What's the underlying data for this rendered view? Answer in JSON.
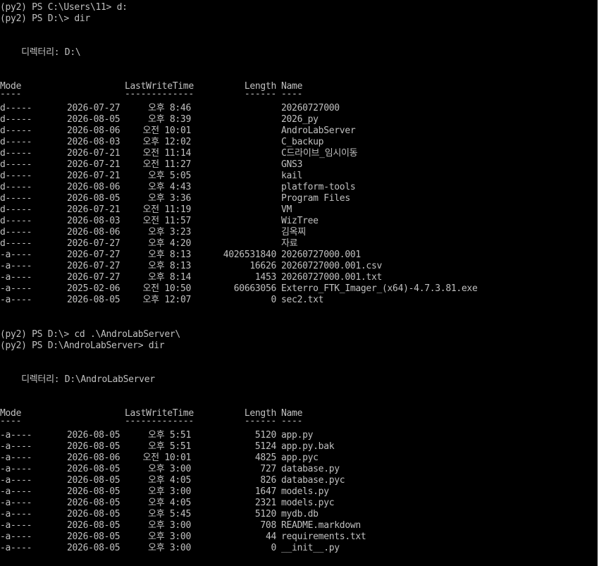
{
  "session1": {
    "prompt_cd": "(py2) PS C:\\Users\\11> d:",
    "prompt_dir": "(py2) PS D:\\> dir",
    "directory_label": "    디렉터리: D:\\",
    "header": {
      "mode": "Mode",
      "time": "LastWriteTime",
      "length": "Length",
      "name": "Name"
    },
    "divider": {
      "mode": "----",
      "time": "-------------",
      "length": "------",
      "name": "----"
    },
    "rows": [
      {
        "mode": "d-----",
        "date": "2026-07-27",
        "time": "오후 8:46",
        "length": "",
        "name": "20260727000"
      },
      {
        "mode": "d-----",
        "date": "2026-08-05",
        "time": "오후 8:39",
        "length": "",
        "name": "2026_py"
      },
      {
        "mode": "d-----",
        "date": "2026-08-06",
        "time": "오전 10:01",
        "length": "",
        "name": "AndroLabServer"
      },
      {
        "mode": "d-----",
        "date": "2026-08-03",
        "time": "오후 12:02",
        "length": "",
        "name": "C_backup"
      },
      {
        "mode": "d-----",
        "date": "2026-07-21",
        "time": "오전 11:14",
        "length": "",
        "name": "C드라이브_임시이동"
      },
      {
        "mode": "d-----",
        "date": "2026-07-21",
        "time": "오전 11:27",
        "length": "",
        "name": "GNS3"
      },
      {
        "mode": "d-----",
        "date": "2026-07-21",
        "time": "오후 5:05",
        "length": "",
        "name": "kail"
      },
      {
        "mode": "d-----",
        "date": "2026-08-06",
        "time": "오후 4:43",
        "length": "",
        "name": "platform-tools"
      },
      {
        "mode": "d-----",
        "date": "2026-08-05",
        "time": "오후 3:36",
        "length": "",
        "name": "Program Files"
      },
      {
        "mode": "d-----",
        "date": "2026-07-21",
        "time": "오전 11:19",
        "length": "",
        "name": "VM"
      },
      {
        "mode": "d-----",
        "date": "2026-08-03",
        "time": "오전 11:57",
        "length": "",
        "name": "WizTree"
      },
      {
        "mode": "d-----",
        "date": "2026-08-06",
        "time": "오후 3:23",
        "length": "",
        "name": "김옥찌"
      },
      {
        "mode": "d-----",
        "date": "2026-07-27",
        "time": "오후 4:20",
        "length": "",
        "name": "자료"
      },
      {
        "mode": "-a----",
        "date": "2026-07-27",
        "time": "오후 8:13",
        "length": "4026531840",
        "name": "20260727000.001"
      },
      {
        "mode": "-a----",
        "date": "2026-07-27",
        "time": "오후 8:13",
        "length": "16626",
        "name": "20260727000.001.csv"
      },
      {
        "mode": "-a----",
        "date": "2026-07-27",
        "time": "오후 8:14",
        "length": "1453",
        "name": "20260727000.001.txt"
      },
      {
        "mode": "-a----",
        "date": "2025-02-06",
        "time": "오전 10:50",
        "length": "60663056",
        "name": "Exterro_FTK_Imager_(x64)-4.7.3.81.exe"
      },
      {
        "mode": "-a----",
        "date": "2026-08-05",
        "time": "오후 12:07",
        "length": "0",
        "name": "sec2.txt"
      }
    ]
  },
  "session2": {
    "prompt_cd": "(py2) PS D:\\> cd .\\AndroLabServer\\",
    "prompt_dir": "(py2) PS D:\\AndroLabServer> dir",
    "directory_label": "    디렉터리: D:\\AndroLabServer",
    "header": {
      "mode": "Mode",
      "time": "LastWriteTime",
      "length": "Length",
      "name": "Name"
    },
    "divider": {
      "mode": "----",
      "time": "-------------",
      "length": "------",
      "name": "----"
    },
    "rows": [
      {
        "mode": "-a----",
        "date": "2026-08-05",
        "time": "오후 5:51",
        "length": "5120",
        "name": "app.py"
      },
      {
        "mode": "-a----",
        "date": "2026-08-05",
        "time": "오후 5:51",
        "length": "5124",
        "name": "app.py.bak"
      },
      {
        "mode": "-a----",
        "date": "2026-08-06",
        "time": "오전 10:01",
        "length": "4825",
        "name": "app.pyc"
      },
      {
        "mode": "-a----",
        "date": "2026-08-05",
        "time": "오후 3:00",
        "length": "727",
        "name": "database.py"
      },
      {
        "mode": "-a----",
        "date": "2026-08-05",
        "time": "오후 4:05",
        "length": "826",
        "name": "database.pyc"
      },
      {
        "mode": "-a----",
        "date": "2026-08-05",
        "time": "오후 3:00",
        "length": "1647",
        "name": "models.py"
      },
      {
        "mode": "-a----",
        "date": "2026-08-05",
        "time": "오후 4:05",
        "length": "2321",
        "name": "models.pyc"
      },
      {
        "mode": "-a----",
        "date": "2026-08-05",
        "time": "오후 5:45",
        "length": "5120",
        "name": "mydb.db"
      },
      {
        "mode": "-a----",
        "date": "2026-08-05",
        "time": "오후 3:00",
        "length": "708",
        "name": "README.markdown"
      },
      {
        "mode": "-a----",
        "date": "2026-08-05",
        "time": "오후 3:00",
        "length": "44",
        "name": "requirements.txt"
      },
      {
        "mode": "-a----",
        "date": "2026-08-05",
        "time": "오후 3:00",
        "length": "0",
        "name": "__init__.py"
      }
    ]
  },
  "colors": {
    "background": "#000000",
    "foreground": "#c0c0c0"
  }
}
